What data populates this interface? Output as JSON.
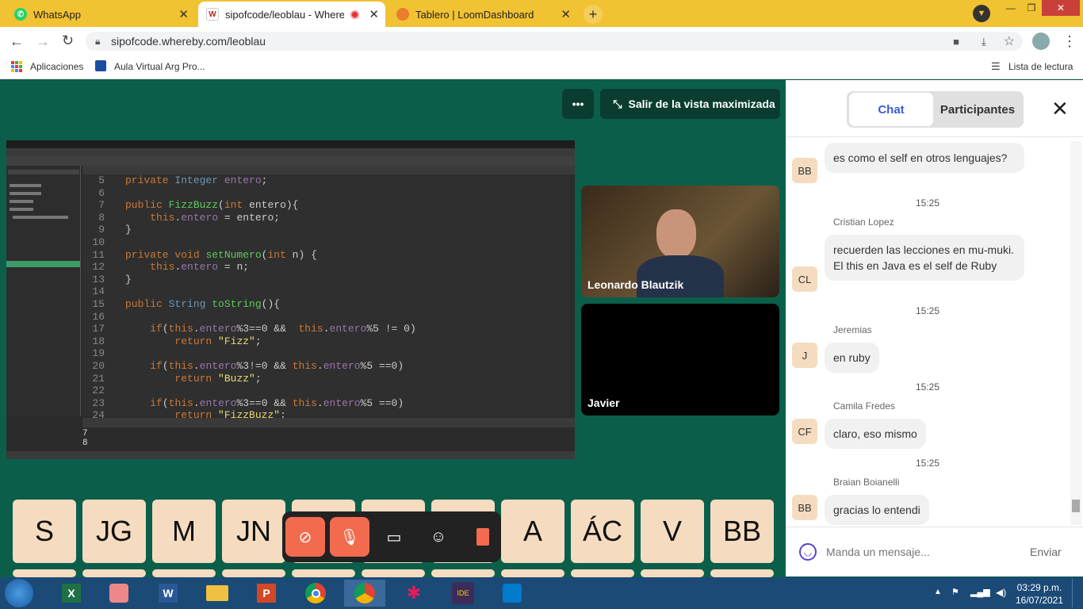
{
  "tabs": [
    {
      "label": "WhatsApp",
      "fav": "",
      "color": "#25d366"
    },
    {
      "label": "sipofcode/leoblau - Whereby",
      "fav": "W",
      "color": "#b22"
    },
    {
      "label": "Tablero | LoomDashboard",
      "fav": "",
      "color": "#e97d2c"
    }
  ],
  "address": {
    "url": "sipofcode.whereby.com/leoblau"
  },
  "bookmarks": {
    "apps": "Aplicaciones",
    "aula": "Aula Virtual Arg Pro...",
    "reading": "Lista de lectura"
  },
  "meeting": {
    "more": "•••",
    "exit_label": "Salir de la vista maximizada"
  },
  "code": [
    {
      "n": "5",
      "h": "<span class=\"kw\">private</span> <span class=\"ty\">Integer</span> <span class=\"vr\">entero</span>;"
    },
    {
      "n": "6",
      "h": ""
    },
    {
      "n": "7",
      "h": "<span class=\"kw\">public</span> <span class=\"fn\">FizzBuzz</span>(<span class=\"kw\">int</span> entero){"
    },
    {
      "n": "8",
      "h": "    <span class=\"kw\">this</span>.<span class=\"vr\">entero</span> = entero;"
    },
    {
      "n": "9",
      "h": "}"
    },
    {
      "n": "10",
      "h": ""
    },
    {
      "n": "11",
      "h": "<span class=\"kw\">private void</span> <span class=\"fn\">setNumero</span>(<span class=\"kw\">int</span> n) {"
    },
    {
      "n": "12",
      "h": "    <span class=\"kw\">this</span>.<span class=\"vr\">entero</span> = n;"
    },
    {
      "n": "13",
      "h": "}"
    },
    {
      "n": "14",
      "h": ""
    },
    {
      "n": "15",
      "h": "<span class=\"kw\">public</span> <span class=\"ty\">String</span> <span class=\"fn\">toString</span>(){"
    },
    {
      "n": "16",
      "h": ""
    },
    {
      "n": "17",
      "h": "    <span class=\"kw\">if</span>(<span class=\"kw\">this</span>.<span class=\"vr\">entero</span>%3==0 &&  <span class=\"kw\">this</span>.<span class=\"vr\">entero</span>%5 != 0)"
    },
    {
      "n": "18",
      "h": "        <span class=\"kw\">return</span> <span class=\"st\">\"Fizz\"</span>;"
    },
    {
      "n": "19",
      "h": ""
    },
    {
      "n": "20",
      "h": "    <span class=\"kw\">if</span>(<span class=\"kw\">this</span>.<span class=\"vr\">entero</span>%3!=0 && <span class=\"kw\">this</span>.<span class=\"vr\">entero</span>%5 ==0)"
    },
    {
      "n": "21",
      "h": "        <span class=\"kw\">return</span> <span class=\"st\">\"Buzz\"</span>;"
    },
    {
      "n": "22",
      "h": ""
    },
    {
      "n": "23",
      "h": "    <span class=\"kw\">if</span>(<span class=\"kw\">this</span>.<span class=\"vr\">entero</span>%3==0 && <span class=\"kw\">this</span>.<span class=\"vr\">entero</span>%5 ==0)"
    },
    {
      "n": "24",
      "h": "        <span class=\"kw\">return</span> <span class=\"st\">\"FizzBuzz\"</span>;"
    }
  ],
  "console": {
    "line1": "7",
    "line2": "8"
  },
  "participants": {
    "leo": "Leonardo Blautzik",
    "javier": "Javier"
  },
  "avatars": [
    "S",
    "JG",
    "M",
    "JN",
    "",
    "",
    "",
    "A",
    "ÁC",
    "V",
    "BB"
  ],
  "chat": {
    "tab_chat": "Chat",
    "tab_participants": "Participantes",
    "messages": [
      {
        "av": "BB",
        "name": "",
        "time": "",
        "text": "es como el self en otros lenguajes?"
      },
      {
        "av": "CL",
        "name": "Cristian Lopez",
        "time": "15:25",
        "text": "recuerden las lecciones en mu-muki. El this en Java es el self de Ruby"
      },
      {
        "av": "J",
        "name": "Jeremias",
        "time": "15:25",
        "text": "en ruby"
      },
      {
        "av": "CF",
        "name": "Camila Fredes",
        "time": "15:25",
        "text": "claro, eso mismo"
      },
      {
        "av": "BB",
        "name": "Braian Boianelli",
        "time": "15:25",
        "text": "gracias lo entendi"
      }
    ],
    "placeholder": "Manda un mensaje...",
    "send": "Enviar"
  },
  "clock": {
    "time": "03:29 p.m.",
    "date": "16/07/2021"
  }
}
